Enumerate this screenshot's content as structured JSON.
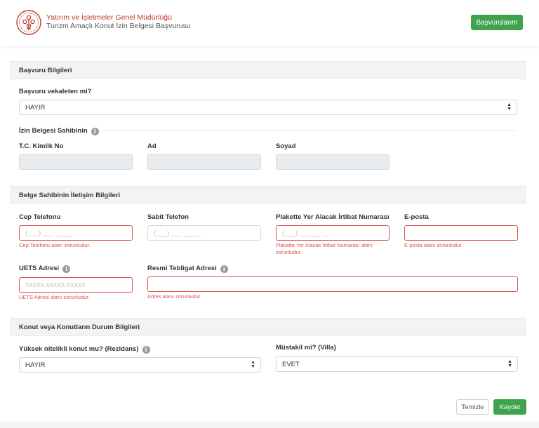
{
  "header": {
    "org_title": "Yatırım ve İşletmeler Genel Müdürlüğü",
    "app_subtitle": "Turizm Amaçlı Konut İzin Belgesi Başvurusu",
    "my_applications_label": "Başvurularım"
  },
  "basvuru_bilgileri": {
    "title": "Başvuru Bilgileri",
    "vekalet_label": "Başvuru vekaleten mi?",
    "vekalet_value": "HAYIR",
    "sahip_heading": "İzin Belgesi Sahibinin",
    "tc_label": "T.C. Kimlik No",
    "ad_label": "Ad",
    "soyad_label": "Soyad"
  },
  "iletisim": {
    "title": "Belge Sahibinin İletişim Bilgileri",
    "cep_label": "Cep Telefonu",
    "cep_placeholder": "(___) ___ __ __",
    "cep_error": "Cep Telefonu alanı zorunludur.",
    "sabit_label": "Sabit Telefon",
    "sabit_placeholder": "(___) ___ __ __",
    "plaket_label": "Plakette Yer Alacak İrtibat Numarası",
    "plaket_placeholder": "(___) ___ __ __",
    "plaket_error": "Plakette Yer Alacak İrtibat Numarası alanı zorunludur.",
    "eposta_label": "E-posta",
    "eposta_placeholder": "",
    "eposta_error": "E-posta alanı zorunludur.",
    "uets_label": "UETS Adresi",
    "uets_placeholder": "XXXXX-XXXXX-XXXXX",
    "uets_error": "UETS Adresi alanı zorunludur.",
    "teblig_label": "Resmi Tebligat Adresi",
    "teblig_error": "Adres alanı zorunludur."
  },
  "konut": {
    "title": "Konut veya Konutların Durum Bilgileri",
    "rezidans_label": "Yüksek nitelikli konut mu? (Rezidans)",
    "rezidans_value": "HAYIR",
    "villa_label": "Müstakil mi? (Villa)",
    "villa_value": "EVET"
  },
  "actions": {
    "clear_label": "Temizle",
    "save_label": "Kaydet"
  },
  "colors": {
    "primary_green": "#3fa34d",
    "error_red": "#d9534f",
    "brand_red": "#c0392b"
  },
  "icons": {
    "logo": "ministry-emblem-icon",
    "info": "info-icon",
    "select_arrows": "sort-arrows-icon"
  }
}
